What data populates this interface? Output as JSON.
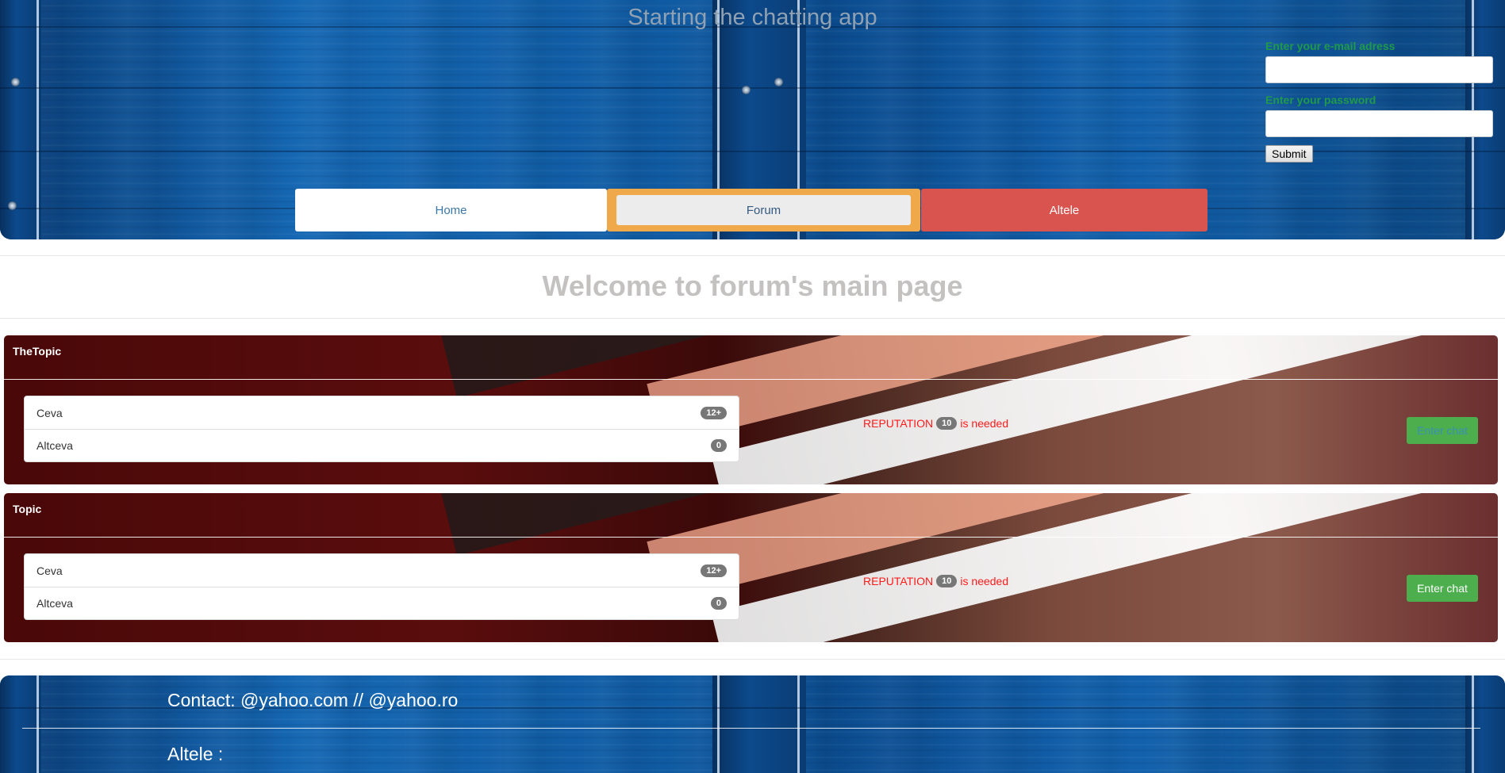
{
  "header": {
    "title": "Starting the chatting app"
  },
  "login": {
    "email_label": "Enter your e-mail adress",
    "password_label": "Enter your password",
    "submit_label": "Submit"
  },
  "nav": {
    "items": [
      {
        "label": "Home"
      },
      {
        "label": "Forum"
      },
      {
        "label": "Altele"
      }
    ]
  },
  "main": {
    "welcome": "Welcome to forum's main page",
    "topics": [
      {
        "title": "TheTopic",
        "items": [
          {
            "label": "Ceva",
            "badge": "12+"
          },
          {
            "label": "Altceva",
            "badge": "0"
          }
        ],
        "reputation_prefix": "REPUTATION",
        "reputation_value": "10",
        "reputation_suffix": "is needed",
        "enter_label": "Enter chat"
      },
      {
        "title": "Topic",
        "items": [
          {
            "label": "Ceva",
            "badge": "12+"
          },
          {
            "label": "Altceva",
            "badge": "0"
          }
        ],
        "reputation_prefix": "REPUTATION",
        "reputation_value": "10",
        "reputation_suffix": "is needed",
        "enter_label": "Enter chat"
      }
    ]
  },
  "footer": {
    "contact": "Contact: @yahoo.com // @yahoo.ro",
    "other": "Altele :"
  },
  "colors": {
    "wood_blue": "#0d4f93",
    "login_label_green": "#1f9a4a",
    "forum_highlight": "#efa94a",
    "altele_red": "#d9534f",
    "enter_green": "#4cae4c",
    "reputation_red": "#ff1a1a"
  }
}
